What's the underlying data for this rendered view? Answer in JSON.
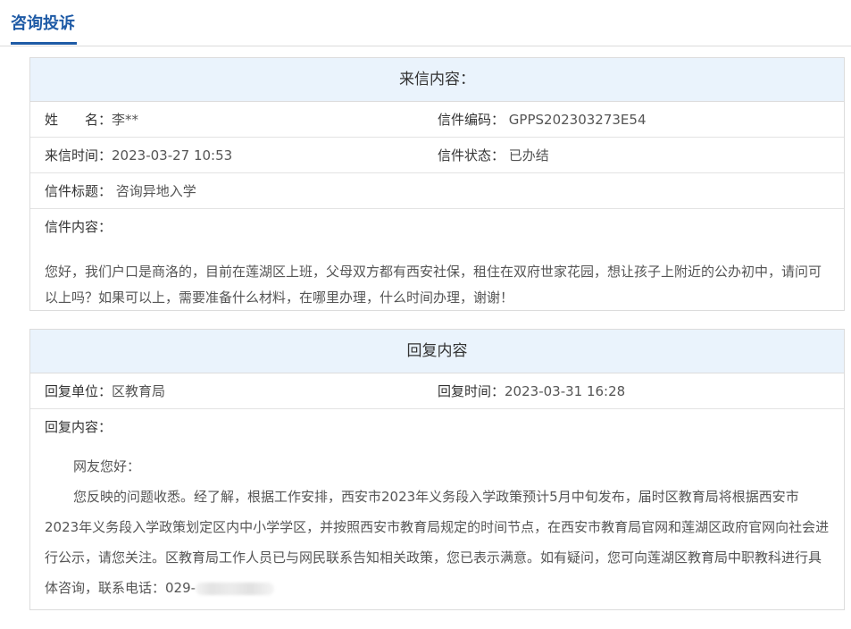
{
  "header": {
    "title": "咨询投诉"
  },
  "letter": {
    "section_title": "来信内容：",
    "name_label": "姓　　名：",
    "name_value": "李**",
    "code_label": "信件编码：",
    "code_value": "GPPS202303273E54",
    "time_label": "来信时间：",
    "time_value": "2023-03-27 10:53",
    "status_label": "信件状态：",
    "status_value": "已办结",
    "subject_label": "信件标题：",
    "subject_value": "咨询异地入学",
    "content_label": "信件内容：",
    "content_text": "您好，我们户口是商洛的，目前在莲湖区上班，父母双方都有西安社保，租住在双府世家花园，想让孩子上附近的公办初中，请问可以上吗？如果可以上，需要准备什么材料，在哪里办理，什么时间办理，谢谢！"
  },
  "reply": {
    "section_title": "回复内容",
    "unit_label": "回复单位：",
    "unit_value": "区教育局",
    "time_label": "回复时间：",
    "time_value": "2023-03-31 16:28",
    "content_label": "回复内容：",
    "greeting": "网友您好：",
    "body": "您反映的问题收悉。经了解，根据工作安排，西安市2023年义务段入学政策预计5月中旬发布，届时区教育局将根据西安市2023年义务段入学政策划定区内中小学学区，并按照西安市教育局规定的时间节点，在西安市教育局官网和莲湖区政府官网向社会进行公示，请您关注。区教育局工作人员已与网民联系告知相关政策，您已表示满意。如有疑问，您可向莲湖区教育局中职教科进行具体咨询，联系电话：",
    "phone_prefix": "029-"
  }
}
